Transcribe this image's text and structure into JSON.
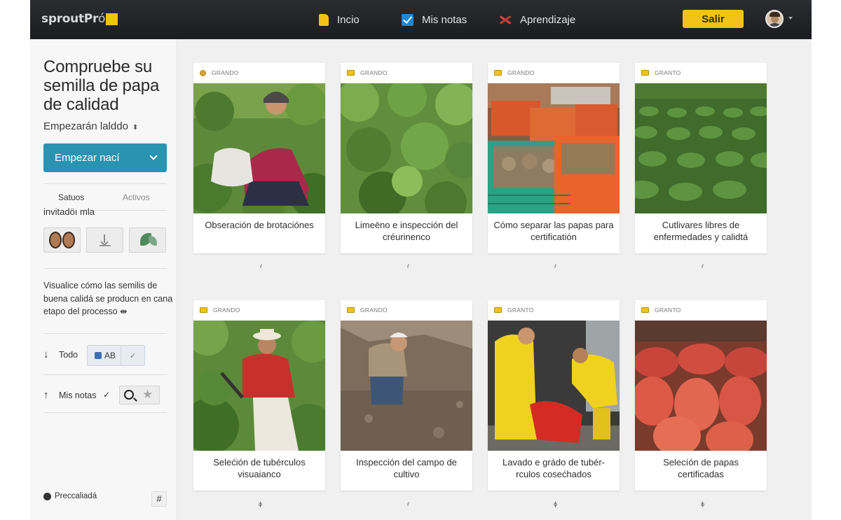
{
  "app": {
    "logo_main": "sproutPr",
    "logo_tail": "ó",
    "nav": [
      {
        "label": "Incio",
        "icon": "folder-icon"
      },
      {
        "label": "Mis notas",
        "icon": "checkbox-icon"
      },
      {
        "label": "Aprendizaje",
        "icon": "cross-icon"
      }
    ],
    "exit_label": "Salir"
  },
  "sidebar": {
    "title": "Compruebe su semilla de papa de calidad",
    "subtitle": "Empezarán lalddo",
    "subtitle_arrow": "⬍",
    "start_button": "Empezar nací",
    "tab_status": "Satuos",
    "tab_active": "Activos",
    "invited": "invitadöı mla",
    "description": "Visualice cómo las semilis de buena calidá se producn en cana etapo del processo",
    "description_arrow": "⇼",
    "row_all_label": "Todo",
    "row_all_arrow": "↓",
    "seg_ab": "AB",
    "seg_check": "✓",
    "row_notes_label": "Mis notas",
    "row_notes_arrow": "↑",
    "row_notes_check": "✓",
    "footer_label": "Preccaliadá",
    "footer_hash": "#"
  },
  "cards": [
    {
      "header": "GRANDO",
      "caption": "Obseración de brotaciónes",
      "mark": "ɾ"
    },
    {
      "header": "GRANDO",
      "caption": "Limeëno e inspección del créurinenco",
      "mark": "ɾ"
    },
    {
      "header": "GRANDO",
      "caption": "Cómo separar las papas para certificatión",
      "mark": "ɾ"
    },
    {
      "header": "GRANTO",
      "caption": "Cutlivares libres de enfermedades y calidtá",
      "mark": "ɾ"
    },
    {
      "header": "GRANDO",
      "caption": "Selećión de tubérculos visuaianco",
      "mark": "ɸ"
    },
    {
      "header": "GRANDO",
      "caption": "Inspección del campo de cultivo",
      "mark": "ɾ"
    },
    {
      "header": "GRANTO",
      "caption": "Lavado e grádo de tubér-rculos cosećhados",
      "mark": "ɸ"
    },
    {
      "header": "GRANTO",
      "caption": "Selecíón de papas certificadas",
      "mark": "ɸ"
    }
  ],
  "colors": {
    "accent": "#2a93b2",
    "brand_yellow": "#f2c316",
    "topbar": "#1e1f23"
  }
}
